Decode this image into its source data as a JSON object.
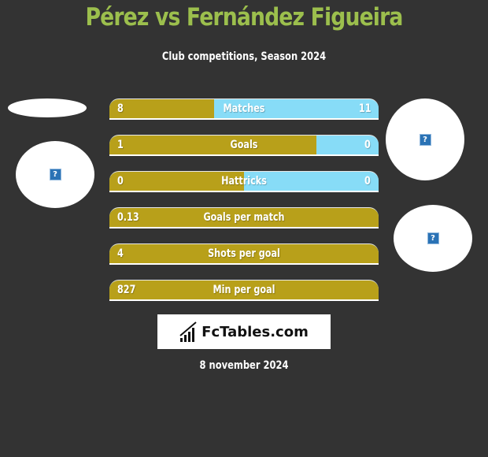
{
  "header": {
    "title": "Pérez vs Fernández Figueira",
    "subtitle": "Club competitions, Season 2024"
  },
  "colors": {
    "background": "#333333",
    "title": "#9cbf4d",
    "left_bar": "#b8a01a",
    "right_bar": "#87dcf7"
  },
  "players": {
    "left": {
      "image_icon": "broken-image-icon",
      "icon_glyph": "?"
    },
    "right": {
      "image_icon": "broken-image-icon",
      "icon_glyph": "?"
    }
  },
  "stats": [
    {
      "label": "Matches",
      "left": "8",
      "right": "11",
      "left_share": 0.39
    },
    {
      "label": "Goals",
      "left": "1",
      "right": "0",
      "left_share": 0.77
    },
    {
      "label": "Hattricks",
      "left": "0",
      "right": "0",
      "left_share": 0.5
    },
    {
      "label": "Goals per match",
      "left": "0.13",
      "right": "",
      "left_share": 1.0
    },
    {
      "label": "Shots per goal",
      "left": "4",
      "right": "",
      "left_share": 1.0
    },
    {
      "label": "Min per goal",
      "left": "827",
      "right": "",
      "left_share": 1.0
    }
  ],
  "footer": {
    "logo_text": "FcTables.com",
    "date": "8 november 2024"
  }
}
